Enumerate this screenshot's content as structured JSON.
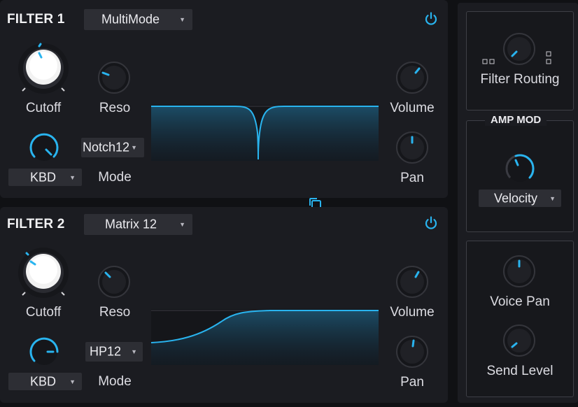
{
  "filter1": {
    "title": "FILTER 1",
    "type": "MultiMode",
    "power_on": true,
    "cutoff_label": "Cutoff",
    "reso_label": "Reso",
    "volume_label": "Volume",
    "pan_label": "Pan",
    "kbd_label": "KBD",
    "mode_label": "Mode",
    "mode_value": "Notch12"
  },
  "filter2": {
    "title": "FILTER 2",
    "type": "Matrix 12",
    "power_on": true,
    "cutoff_label": "Cutoff",
    "reso_label": "Reso",
    "volume_label": "Volume",
    "pan_label": "Pan",
    "kbd_label": "KBD",
    "mode_label": "Mode",
    "mode_value": "HP12"
  },
  "routing": {
    "label": "Filter Routing"
  },
  "amp_mod": {
    "title": "AMP MOD",
    "source": "Velocity"
  },
  "voice": {
    "voice_pan_label": "Voice Pan",
    "send_level_label": "Send Level"
  },
  "colors": {
    "accent": "#29b4ef",
    "panel": "#1b1c21",
    "background": "#101114",
    "dropdown": "#2d2e34"
  },
  "icons": [
    "power-icon",
    "copy-icon",
    "routing-left-icon",
    "routing-right-icon",
    "dropdown-arrow-icon"
  ]
}
